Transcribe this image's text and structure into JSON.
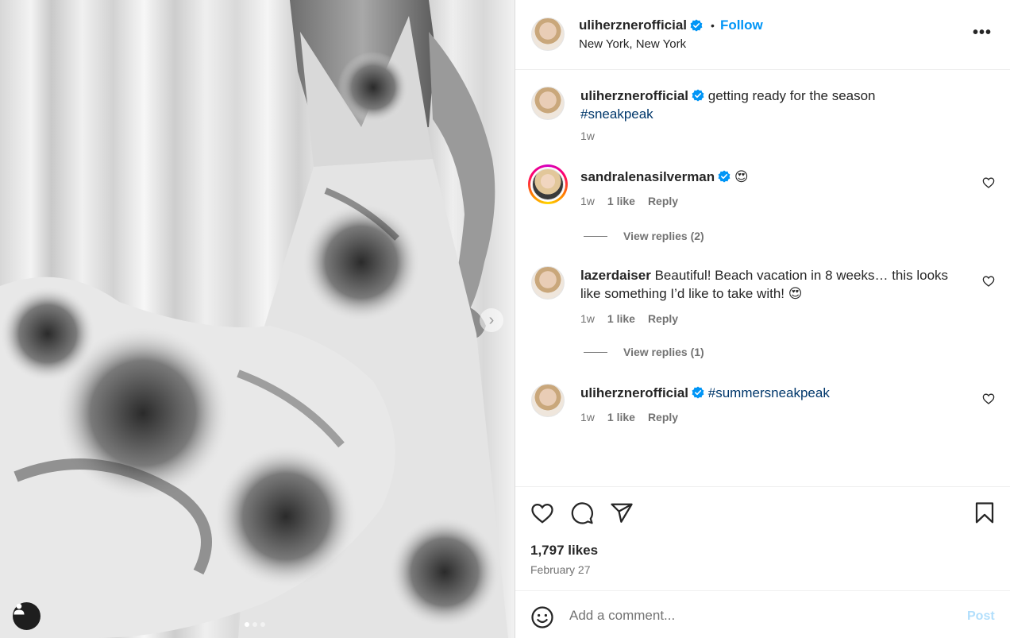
{
  "post": {
    "author": "uliherznerofficial",
    "follow_label": "Follow",
    "separator": "•",
    "location": "New York, New York",
    "more_label": "•••",
    "next_label": "›"
  },
  "caption": {
    "username": "uliherznerofficial",
    "text": "getting ready for the season",
    "hashtag": "#sneakpeak",
    "time": "1w"
  },
  "comments": [
    {
      "username": "sandralenasilverman",
      "text": "😍",
      "time": "1w",
      "likes": "1 like",
      "reply_label": "Reply",
      "view_replies": "View replies (2)"
    },
    {
      "username": "lazerdaiser",
      "text": "Beautiful! Beach vacation in 8 weeks… this looks like something I’d like to take with! 😍",
      "time": "1w",
      "likes": "1 like",
      "reply_label": "Reply",
      "view_replies": "View replies (1)"
    },
    {
      "username": "uliherznerofficial",
      "text": "#summersneakpeak",
      "time": "1w",
      "likes": "1 like",
      "reply_label": "Reply"
    }
  ],
  "stats": {
    "likes": "1,797 likes",
    "date": "February 27"
  },
  "composer": {
    "placeholder": "Add a comment...",
    "post_label": "Post"
  },
  "icons": {
    "verified": "verified-badge-icon",
    "heart": "heart-icon",
    "comment": "comment-icon",
    "share": "share-icon",
    "bookmark": "bookmark-icon",
    "emoji": "emoji-icon",
    "user_tag": "user-tag-icon",
    "next": "chevron-right-icon"
  },
  "colors": {
    "accent": "#0095f6",
    "hashtag": "#00376b",
    "muted": "#737373",
    "post_disabled": "#b2dffc"
  },
  "carousel": {
    "count": 3,
    "active_index": 0
  }
}
